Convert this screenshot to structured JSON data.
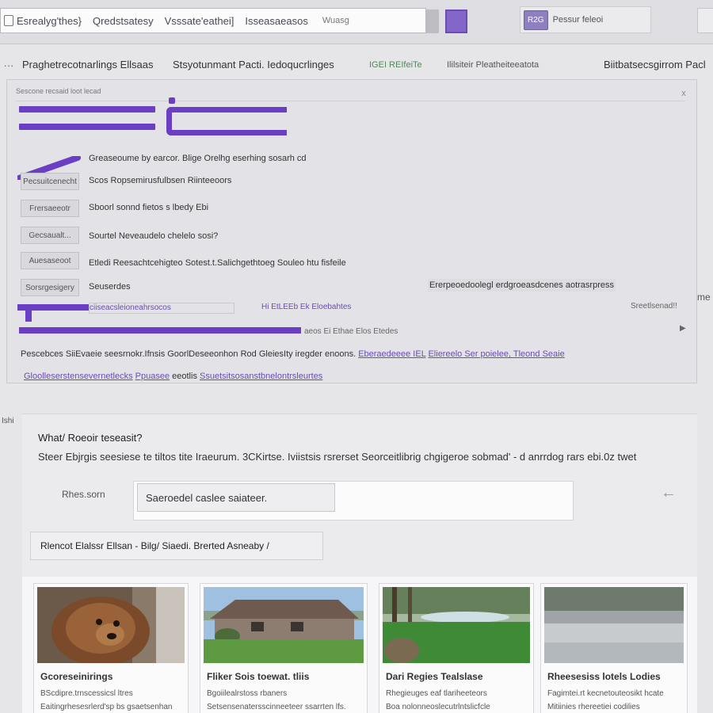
{
  "browser": {
    "url_segments": [
      "Esrealyg'thes}",
      "Qredstsatesy",
      "Vsssate'eathei]",
      "Isseasaeasos"
    ],
    "url_tail": "Wuasg",
    "account_badge": "R2G",
    "account_name": "Pessur feleoi"
  },
  "nav": {
    "menu_icon": "···",
    "items": [
      "Praghetrecotnarlings Ellsaas",
      "Stsyotunmant Pacti. Iedoqucrlinges",
      "IGEI REIfeiTe",
      "Ililsiteir Pleatheiteeatota",
      "Biitbatsecsgirrom Pacl"
    ]
  },
  "panel": {
    "header_text": "Sescone recsaid loot lecad",
    "close_icon": "x",
    "intro": "Greaseoume by earcor. Blige Orelhg eserhing sosarh cd",
    "rows": [
      {
        "tag": "Pecsuitcenecht",
        "text": "Scos Ropsemirusfulbsen Riinteeoors"
      },
      {
        "tag": "Frersaeeotr",
        "text": "Sboorl sonnd fietos s lbedy Ebi"
      },
      {
        "tag": "Gecsaualt...",
        "text": "Sourtel Neveaudelo chelelo sosi?"
      },
      {
        "tag": "Auesaseoot",
        "text": "Etledi Reesachtcehigteo Sotest.t.Salichgethtoeg Souleo htu fisfeile"
      },
      {
        "tag": "Sorsrgesigery",
        "text": "Seuserdes"
      }
    ],
    "right_note": "Ererpeoedoolegl erdgroeasdcenes aotrasrpress",
    "sub_link": "ciiseacsleioneahrsocos",
    "meta_mid": "Hi  EtLEEb Ek  Eloebahtes",
    "meta_right": "Sreetlsenad!!",
    "line_meta": "aeos  Ei Ethae  Elos  Etedes",
    "arrow_icon": "▶",
    "desc_text": "Pescebces  SiiEvaeie seesrnokr.Ifnsis  GoorlDeseeonhon  Rod  GleiesIty iregder enoons.",
    "desc_links": [
      "Eberaedeeee  IEL",
      "Eliereelo Ser  poielee,  Tleond  Seaie"
    ],
    "tags_link": "Gloolleserstensevernetlecks",
    "tags_link2": "Ppuasee",
    "tags_plain": "eeotlis",
    "tags_link3": "Ssuetsitsosanstbnelontrsleurtes",
    "left_edge": "Ishi",
    "right_edge": "me"
  },
  "search": {
    "question": "What/ Roeoir teseasit?",
    "description": "Steer Ebjrgis  seesiese te tiltos  tite  Iraeurum.  3CKirtse.  Iviistsis  rsrerset  Seorceitlibrig  chgigeroe  sobmad'  - d  anrrdog  rars  ebi.0z  twet",
    "field_label": "Rhes.sorn",
    "input_value": "Saeroedel  caslee  saiateer.",
    "back_icon": "←",
    "filter_text": "Rlencot Elalssr  Ellsan - Bilg/  Siaedi.    Brerted  Asneaby /"
  },
  "cards": [
    {
      "title": "Gcoreseinirings",
      "line1": "BScdipre.trnscessicsl ltres",
      "line2": "Eaitingrhesesrlerd'sp bs gsaetsenhan",
      "image": "animal-photo"
    },
    {
      "title": "Fliker  Sois toewat. tliis",
      "line1": "Bgoiilealrstoss  rbaners",
      "line2": "Setsensenatersscinneeteer ssarrten lfs.",
      "image": "house-photo"
    },
    {
      "title": "Dari Regies Tealslase",
      "line1": "Rhegieuges eaf tlariheeteors",
      "line2": "Boa nolonneoslecutrlntslicfcle",
      "image": "pond-photo"
    },
    {
      "title": "Rheesesiss lotels  Lodies",
      "line1": "Fagimtei.rt kecnetouteosikt hcate",
      "line2": "Mitiinies rhereetiei codilies",
      "image": "field-photo"
    }
  ],
  "colors": {
    "accent": "#6b3fc4",
    "link": "#6a4cb3"
  }
}
